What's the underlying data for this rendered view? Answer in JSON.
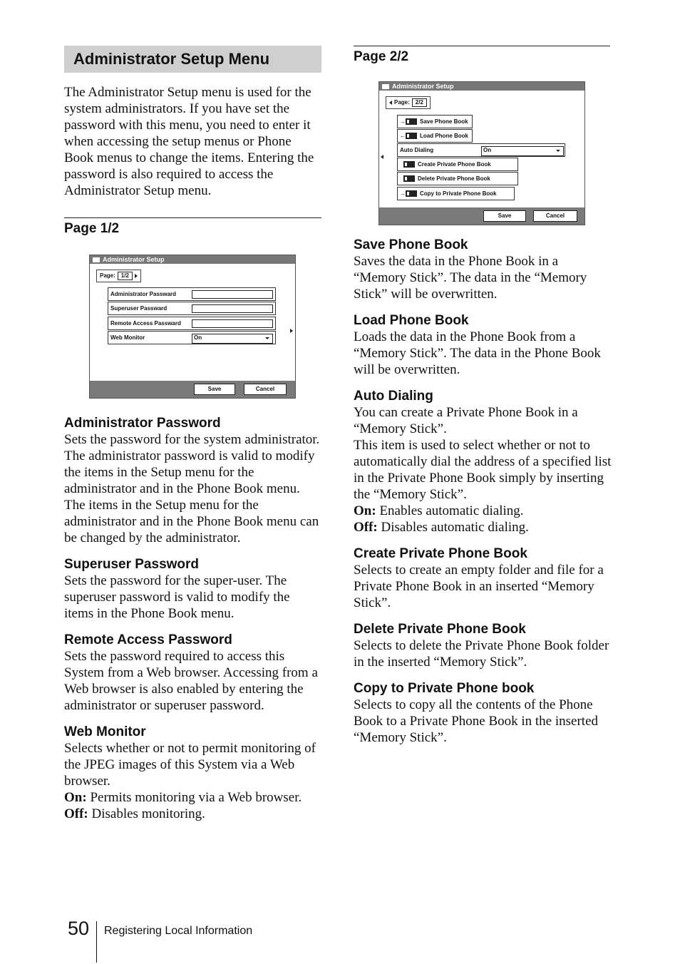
{
  "banner_title": "Administrator Setup Menu",
  "intro": "The Administrator Setup menu is used for the system administrators. If you have set the password with this menu, you need to enter it when accessing the setup menus or Phone Book menus to change the items. Entering the password is also required to access the Administrator Setup menu.",
  "page1": {
    "heading": "Page 1/2",
    "screen": {
      "title": "Administrator Setup",
      "page_label": "Page:",
      "page_value": "1/2",
      "rows": [
        {
          "label": "Administrator Passward",
          "value": ""
        },
        {
          "label": "Superuser Passward",
          "value": ""
        },
        {
          "label": "Remote Access Passward",
          "value": ""
        },
        {
          "label": "Web Monitor",
          "value": "On"
        }
      ],
      "save_label": "Save",
      "cancel_label": "Cancel"
    },
    "sections": [
      {
        "title": "Administrator Password",
        "paragraphs": [
          "Sets the password for the system administrator. The administrator password is valid to modify the items in the Setup menu for the administrator and in the Phone Book menu.",
          "The items in the Setup menu for the administrator and in the Phone Book menu can be changed by the administrator."
        ]
      },
      {
        "title": "Superuser Password",
        "paragraphs": [
          "Sets the password for the super-user. The superuser password is valid to modify the items in the Phone Book menu."
        ]
      },
      {
        "title": "Remote Access Password",
        "paragraphs": [
          "Sets the password required to access this System from a Web browser. Accessing from a Web browser is also enabled by entering the administrator or superuser password."
        ]
      },
      {
        "title": "Web Monitor",
        "paragraphs": [
          "Selects whether or not to permit monitoring of the JPEG images of this System via a Web browser."
        ],
        "options": [
          {
            "key": "On:",
            "text": " Permits monitoring via a Web browser."
          },
          {
            "key": "Off:",
            "text": " Disables monitoring."
          }
        ]
      }
    ]
  },
  "page2": {
    "heading": "Page 2/2",
    "screen": {
      "title": "Administrator Setup",
      "page_label": "Page:",
      "page_value": "2/2",
      "items": [
        {
          "label": "Save Phone Book"
        },
        {
          "label": "Load Phone Book"
        },
        {
          "label": "Auto Dialing",
          "value": "On"
        },
        {
          "label": "Create Private Phone Book"
        },
        {
          "label": "Delete Private Phone Book"
        },
        {
          "label": "Copy to Private Phone Book"
        }
      ],
      "save_label": "Save",
      "cancel_label": "Cancel"
    },
    "sections": [
      {
        "title": "Save Phone Book",
        "paragraphs": [
          "Saves the data in the Phone Book in a “Memory Stick”. The data in the “Memory Stick” will be overwritten."
        ]
      },
      {
        "title": "Load Phone Book",
        "paragraphs": [
          "Loads the data in the Phone Book from a “Memory Stick”. The data in the Phone Book will be overwritten."
        ]
      },
      {
        "title": "Auto Dialing",
        "paragraphs": [
          "You can create a Private Phone Book in a “Memory Stick”.",
          "This item is used to select whether or not to automatically dial the address of a specified list in the Private Phone Book simply by inserting the “Memory Stick”."
        ],
        "options": [
          {
            "key": "On:",
            "text": " Enables automatic dialing."
          },
          {
            "key": "Off:",
            "text": " Disables automatic dialing."
          }
        ]
      },
      {
        "title": "Create Private Phone Book",
        "paragraphs": [
          "Selects to create an empty folder and file for a Private Phone Book in an inserted “Memory Stick”."
        ]
      },
      {
        "title": "Delete Private Phone Book",
        "paragraphs": [
          "Selects to delete the Private Phone Book folder in the inserted “Memory Stick”."
        ]
      },
      {
        "title": "Copy to Private Phone book",
        "paragraphs": [
          "Selects to copy all the contents of the Phone Book to a Private Phone Book in the inserted “Memory Stick”."
        ]
      }
    ]
  },
  "footer": {
    "page_number": "50",
    "section_name": "Registering Local Information"
  }
}
